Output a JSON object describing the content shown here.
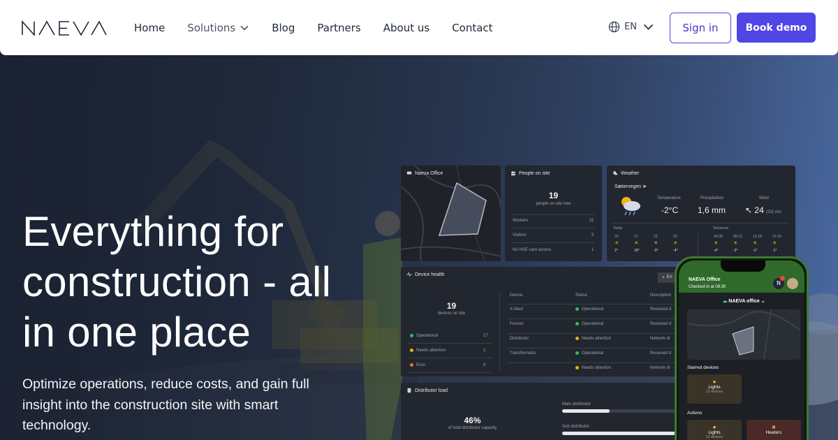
{
  "nav": {
    "logo_text": "NAEVA",
    "links": [
      "Home",
      "Solutions",
      "Blog",
      "Partners",
      "About us",
      "Contact"
    ],
    "language": "EN",
    "sign_in": "Sign in",
    "book_demo": "Book demo",
    "accent_color": "#4f46e5"
  },
  "hero": {
    "title_lines": [
      "Everything for",
      "construction - all",
      "in one place"
    ],
    "subtitle": "Optimize operations, reduce costs, and gain full insight into the construction site with smart technology."
  },
  "dashboard": {
    "map_card": {
      "title": "Naeva Office"
    },
    "people": {
      "title": "People on site",
      "count": "19",
      "caption": "people on site now",
      "rows": [
        {
          "label": "Workers",
          "value": "15"
        },
        {
          "label": "Visitors",
          "value": "3"
        },
        {
          "label": "No HSE card access",
          "value": "1"
        }
      ]
    },
    "weather": {
      "title": "Weather",
      "location": "Sætervegen",
      "temperature_label": "Temperature",
      "temperature": "-2°C",
      "precip_label": "Precipitation",
      "precip": "1,6 mm",
      "wind_label": "Wind",
      "wind": "24",
      "wind_extra": "(32) m/s",
      "today_label": "Today",
      "tomorrow_label": "Tomorrow",
      "today_hours": [
        "20",
        "21",
        "22",
        "23"
      ],
      "today_temps": [
        "2°",
        "10°",
        "-3°",
        "-4°"
      ],
      "tomorrow_hours": [
        "06-06",
        "06-12",
        "12-18",
        "12-18"
      ],
      "tomorrow_temps": [
        "-4°",
        "-2°",
        "-1°",
        "-1°"
      ]
    },
    "device_health": {
      "title": "Device health",
      "button": "Err",
      "count": "19",
      "caption": "devices on site",
      "summary": [
        {
          "label": "Operational",
          "value": "17",
          "color": "#22c55e"
        },
        {
          "label": "Needs attention",
          "value": "2",
          "color": "#eab308"
        },
        {
          "label": "Error",
          "value": "0",
          "color": "#f97316"
        }
      ],
      "columns": [
        "Device",
        "Status",
        "Description"
      ],
      "rows": [
        {
          "device": "X-Mast",
          "status": "Operational",
          "desc": "Received d",
          "color": "#22c55e"
        },
        {
          "device": "Fences",
          "status": "Operational",
          "desc": "Received d",
          "color": "#22c55e"
        },
        {
          "device": "Distributor",
          "status": "Needs attention",
          "desc": "Network di",
          "color": "#eab308"
        },
        {
          "device": "Transformator",
          "status": "Operational",
          "desc": "Received d",
          "color": "#22c55e"
        },
        {
          "device": "",
          "status": "Needs attention",
          "desc": "Network di",
          "color": "#eab308"
        }
      ]
    },
    "distributor": {
      "title": "Distributor load",
      "percent": "46%",
      "caption": "of total distributor capacity",
      "main_label": "Main distributor",
      "main_fill": 0.38,
      "sub_label": "Sub distributor",
      "sub_fill": 0.9
    }
  },
  "phone": {
    "office": "NAEVA Office",
    "checked_in": "Checked in at 08:30",
    "selector": "NAEVA office",
    "starred_label": "Starred devices",
    "starred_tile_name": "Lights",
    "starred_tile_sub": "12 devices",
    "actions_label": "Actions",
    "action_1": "Lights",
    "action_1_sub": "12 devices",
    "action_2": "Heaters",
    "avatar_letter": "N"
  }
}
